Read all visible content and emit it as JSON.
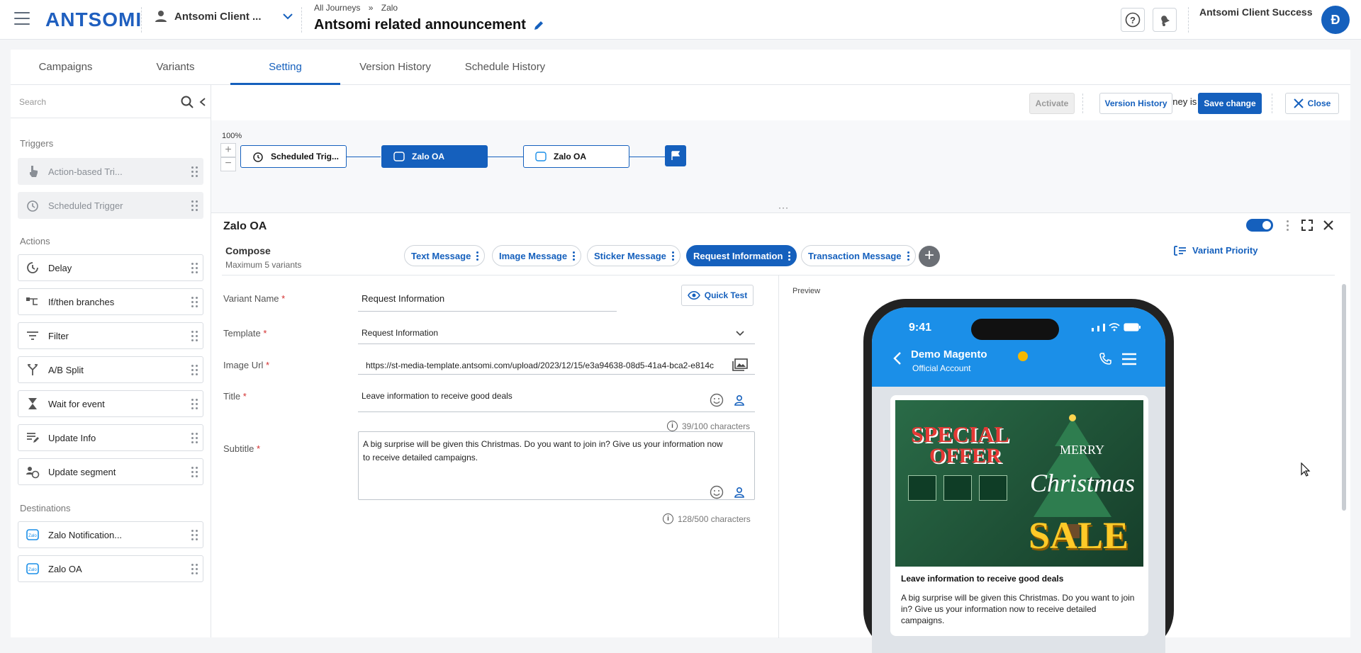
{
  "header": {
    "logo": "ANTSOMI",
    "account": "Antsomi Client ...",
    "breadcrumb": [
      "All Journeys",
      "»",
      "Zalo"
    ],
    "journey_title": "Antsomi related announcement",
    "user_name": "Antsomi Client Success",
    "avatar_initial": "Đ"
  },
  "tabs": [
    "Campaigns",
    "Variants",
    "Setting",
    "Version History",
    "Schedule History"
  ],
  "active_tab": "Setting",
  "sidebar": {
    "search_placeholder": "Search",
    "sections": {
      "triggers": "Triggers",
      "actions": "Actions",
      "destinations": "Destinations"
    },
    "triggers": [
      {
        "label": "Action-based Tri...",
        "icon": "hand-pointer-icon"
      },
      {
        "label": "Scheduled Trigger",
        "icon": "alarm-clock-icon"
      }
    ],
    "actions": [
      {
        "label": "Delay",
        "icon": "delay-clock-icon"
      },
      {
        "label": "If/then branches",
        "icon": "branch-icon"
      },
      {
        "label": "Filter",
        "icon": "filter-icon"
      },
      {
        "label": "A/B Split",
        "icon": "split-icon"
      },
      {
        "label": "Wait for event",
        "icon": "hourglass-icon"
      },
      {
        "label": "Update Info",
        "icon": "edit-list-icon"
      },
      {
        "label": "Update segment",
        "icon": "segment-icon"
      }
    ],
    "destinations": [
      {
        "label": "Zalo Notification...",
        "icon": "zalo-icon"
      },
      {
        "label": "Zalo OA",
        "icon": "zalo-icon"
      }
    ]
  },
  "toolbar": {
    "status": "Journey is In design",
    "activate": "Activate",
    "version_history": "Version History",
    "save": "Save change",
    "close": "Close"
  },
  "canvas": {
    "zoom": "100%",
    "nodes": [
      "Scheduled Trig...",
      "Zalo OA",
      "Zalo OA"
    ]
  },
  "panel": {
    "title": "Zalo OA",
    "compose": "Compose",
    "max_variants": "Maximum 5 variants",
    "variants": [
      "Text Message",
      "Image Message",
      "Sticker Message",
      "Request Information",
      "Transaction Message"
    ],
    "selected_variant": "Request Information",
    "variant_priority": "Variant Priority",
    "quick_test": "Quick Test",
    "preview": "Preview",
    "fields": {
      "variant_name_label": "Variant Name",
      "variant_name": "Request Information",
      "template_label": "Template",
      "template": "Request Information",
      "image_url_label": "Image Url",
      "image_url": "https://st-media-template.antsomi.com/upload/2023/12/15/e3a94638-08d5-41a4-bca2-e814c",
      "title_label": "Title",
      "title": "Leave information to receive good deals",
      "title_count": "39/100 characters",
      "subtitle_label": "Subtitle",
      "subtitle": "A big surprise will be given this Christmas. Do you want to join in? Give us your information now to receive detailed campaigns.",
      "subtitle_count": "128/500 characters"
    }
  },
  "phone": {
    "time": "9:41",
    "oa_name": "Demo Magento",
    "oa_type": "Official Account",
    "banner": {
      "special": "SPECIAL",
      "offer": "OFFER",
      "merry": "MERRY",
      "christmas": "Christmas",
      "sale": "SALE"
    },
    "card_title": "Leave information to receive good deals",
    "card_body": "A big surprise will be given this Christmas. Do you want to join in? Give us your information now to receive detailed campaigns."
  }
}
